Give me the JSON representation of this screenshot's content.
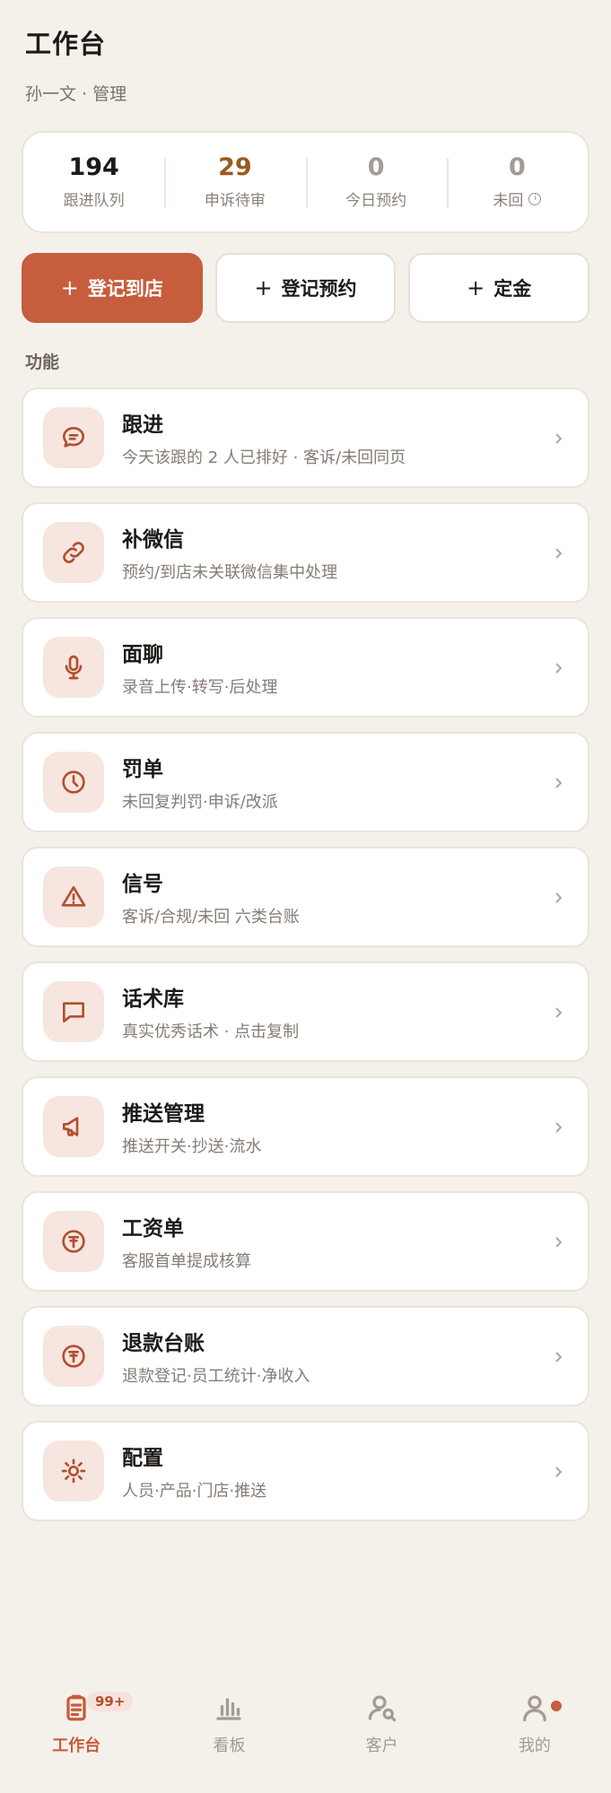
{
  "header": {
    "title": "工作台",
    "subtitle": "孙一文 · 管理"
  },
  "stats": [
    {
      "value": "194",
      "label": "跟进队列",
      "color": "#1E1A17"
    },
    {
      "value": "29",
      "label": "申诉待审",
      "color": "#9A5A1E"
    },
    {
      "value": "0",
      "label": "今日预约",
      "color": "#A39B94"
    },
    {
      "value": "0",
      "label": "未回",
      "color": "#A39B94"
    }
  ],
  "actions": [
    {
      "label": "登记到店",
      "plus": "+"
    },
    {
      "label": "登记预约",
      "plus": "+"
    },
    {
      "label": "定金",
      "plus": "+"
    }
  ],
  "section_label": "功能",
  "items": [
    {
      "title": "跟进",
      "sub": "今天该跟的 2 人已排好 · 客诉/未回同页",
      "icon": "chat-bubble-icon"
    },
    {
      "title": "补微信",
      "sub": "预约/到店未关联微信集中处理",
      "icon": "link-icon"
    },
    {
      "title": "面聊",
      "sub": "录音上传·转写·后处理",
      "icon": "microphone-icon"
    },
    {
      "title": "罚单",
      "sub": "未回复判罚·申诉/改派",
      "icon": "clock-icon"
    },
    {
      "title": "信号",
      "sub": "客诉/合规/未回 六类台账",
      "icon": "warning-icon"
    },
    {
      "title": "话术库",
      "sub": "真实优秀话术 · 点击复制",
      "icon": "message-square-icon"
    },
    {
      "title": "推送管理",
      "sub": "推送开关·抄送·流水",
      "icon": "megaphone-icon"
    },
    {
      "title": "工资单",
      "sub": "客服首单提成核算",
      "icon": "yen-coin-icon"
    },
    {
      "title": "退款台账",
      "sub": "退款登记·员工统计·净收入",
      "icon": "yen-coin-icon"
    },
    {
      "title": "配置",
      "sub": "人员·产品·门店·推送",
      "icon": "sun-settings-icon"
    }
  ],
  "tabbar": [
    {
      "label": "工作台",
      "badge": "99+",
      "active": true,
      "icon": "clipboard-icon"
    },
    {
      "label": "看板",
      "active": false,
      "icon": "bar-chart-icon"
    },
    {
      "label": "客户",
      "active": false,
      "icon": "user-search-icon"
    },
    {
      "label": "我的",
      "active": false,
      "icon": "user-icon"
    }
  ],
  "colors": {
    "accent": "#C65D3D",
    "background": "#F4F0EA",
    "icon_bg": "#F6E6DF"
  }
}
